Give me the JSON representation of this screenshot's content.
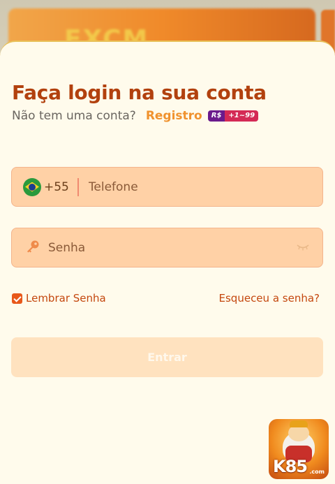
{
  "banner": {
    "text": "EXCM"
  },
  "login": {
    "title": "Faça login na sua conta",
    "no_account_text": "Não tem uma conta?",
    "register_label": "Registro",
    "promo_currency": "R$",
    "promo_amount": "+1~99"
  },
  "phone": {
    "country_code": "+55",
    "placeholder": "Telefone",
    "value": ""
  },
  "password": {
    "placeholder": "Senha",
    "value": ""
  },
  "remember": {
    "label": "Lembrar Senha",
    "checked": true
  },
  "forgot_label": "Esqueceu a senha?",
  "submit_label": "Entrar",
  "app_badge": {
    "brand": "K85",
    "domain": ".com"
  },
  "colors": {
    "title": "#b2410e",
    "accent": "#f0922e",
    "field_bg": "#ffd1a6",
    "button_disabled_bg": "#ffe2bf",
    "sheet_bg": "#fffbec"
  }
}
